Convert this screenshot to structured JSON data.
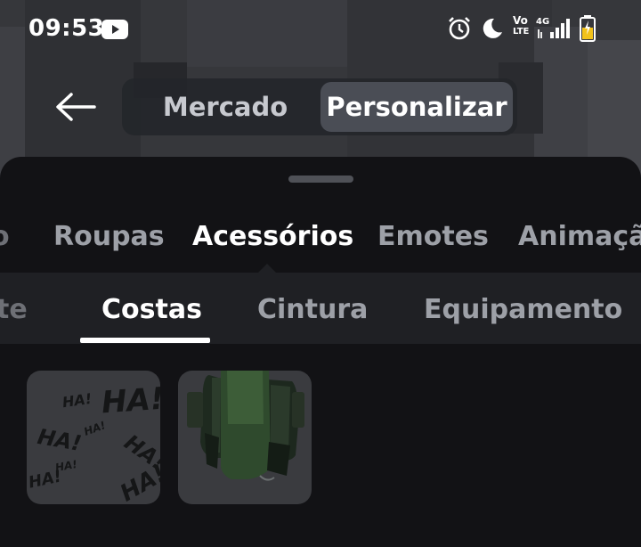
{
  "status_bar": {
    "time": "09:53",
    "icons": [
      "youtube-icon",
      "alarm-icon",
      "moon-icon",
      "volte-icon",
      "4g-signal-icon",
      "battery-icon"
    ],
    "volte_top": "Vo",
    "volte_bottom": "LTE",
    "network": "4G",
    "battery_color": "#f2c21a"
  },
  "header": {
    "back_icon": "arrow-left-icon",
    "segments": [
      {
        "label": "Mercado",
        "selected": false
      },
      {
        "label": "Personalizar",
        "selected": true
      }
    ]
  },
  "category_tabs": [
    {
      "label": "o",
      "selected": false
    },
    {
      "label": "Roupas",
      "selected": false
    },
    {
      "label": "Acessórios",
      "selected": true
    },
    {
      "label": "Emotes",
      "selected": false
    },
    {
      "label": "Animação",
      "selected": false
    }
  ],
  "subcategory_tabs": [
    {
      "label": "te",
      "selected": false
    },
    {
      "label": "Costas",
      "selected": true
    },
    {
      "label": "Cintura",
      "selected": false
    },
    {
      "label": "Equipamento",
      "selected": false
    }
  ],
  "items": [
    {
      "name": "HA! pattern back accessory",
      "text": "HA!"
    },
    {
      "name": "Green armored backpack"
    }
  ],
  "colors": {
    "sheet": "#121215",
    "subbar": "#1f2024",
    "tile": "#3a3b3f",
    "segment_selected": "#4a4d55",
    "inactive_text": "#9da0a7"
  }
}
